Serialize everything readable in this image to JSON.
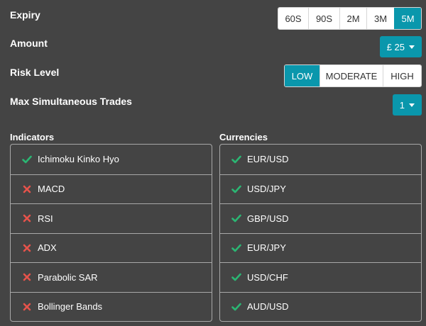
{
  "expiry": {
    "label": "Expiry",
    "options": [
      "60S",
      "90S",
      "2M",
      "3M",
      "5M"
    ],
    "selected": "5M"
  },
  "amount": {
    "label": "Amount",
    "value": "£ 25"
  },
  "risk": {
    "label": "Risk Level",
    "options": [
      "LOW",
      "MODERATE",
      "HIGH"
    ],
    "selected": "LOW"
  },
  "max_trades": {
    "label": "Max Simultaneous Trades",
    "value": "1"
  },
  "indicators": {
    "title": "Indicators",
    "items": [
      {
        "label": "Ichimoku Kinko Hyo",
        "enabled": true
      },
      {
        "label": "MACD",
        "enabled": false
      },
      {
        "label": "RSI",
        "enabled": false
      },
      {
        "label": "ADX",
        "enabled": false
      },
      {
        "label": "Parabolic SAR",
        "enabled": false
      },
      {
        "label": "Bollinger Bands",
        "enabled": false
      }
    ]
  },
  "currencies": {
    "title": "Currencies",
    "items": [
      {
        "label": "EUR/USD",
        "enabled": true
      },
      {
        "label": "USD/JPY",
        "enabled": true
      },
      {
        "label": "GBP/USD",
        "enabled": true
      },
      {
        "label": "EUR/JPY",
        "enabled": true
      },
      {
        "label": "USD/CHF",
        "enabled": true
      },
      {
        "label": "AUD/USD",
        "enabled": true
      }
    ]
  },
  "colors": {
    "accent": "#0a97ac",
    "check": "#2bb673",
    "cross": "#e5534b"
  }
}
